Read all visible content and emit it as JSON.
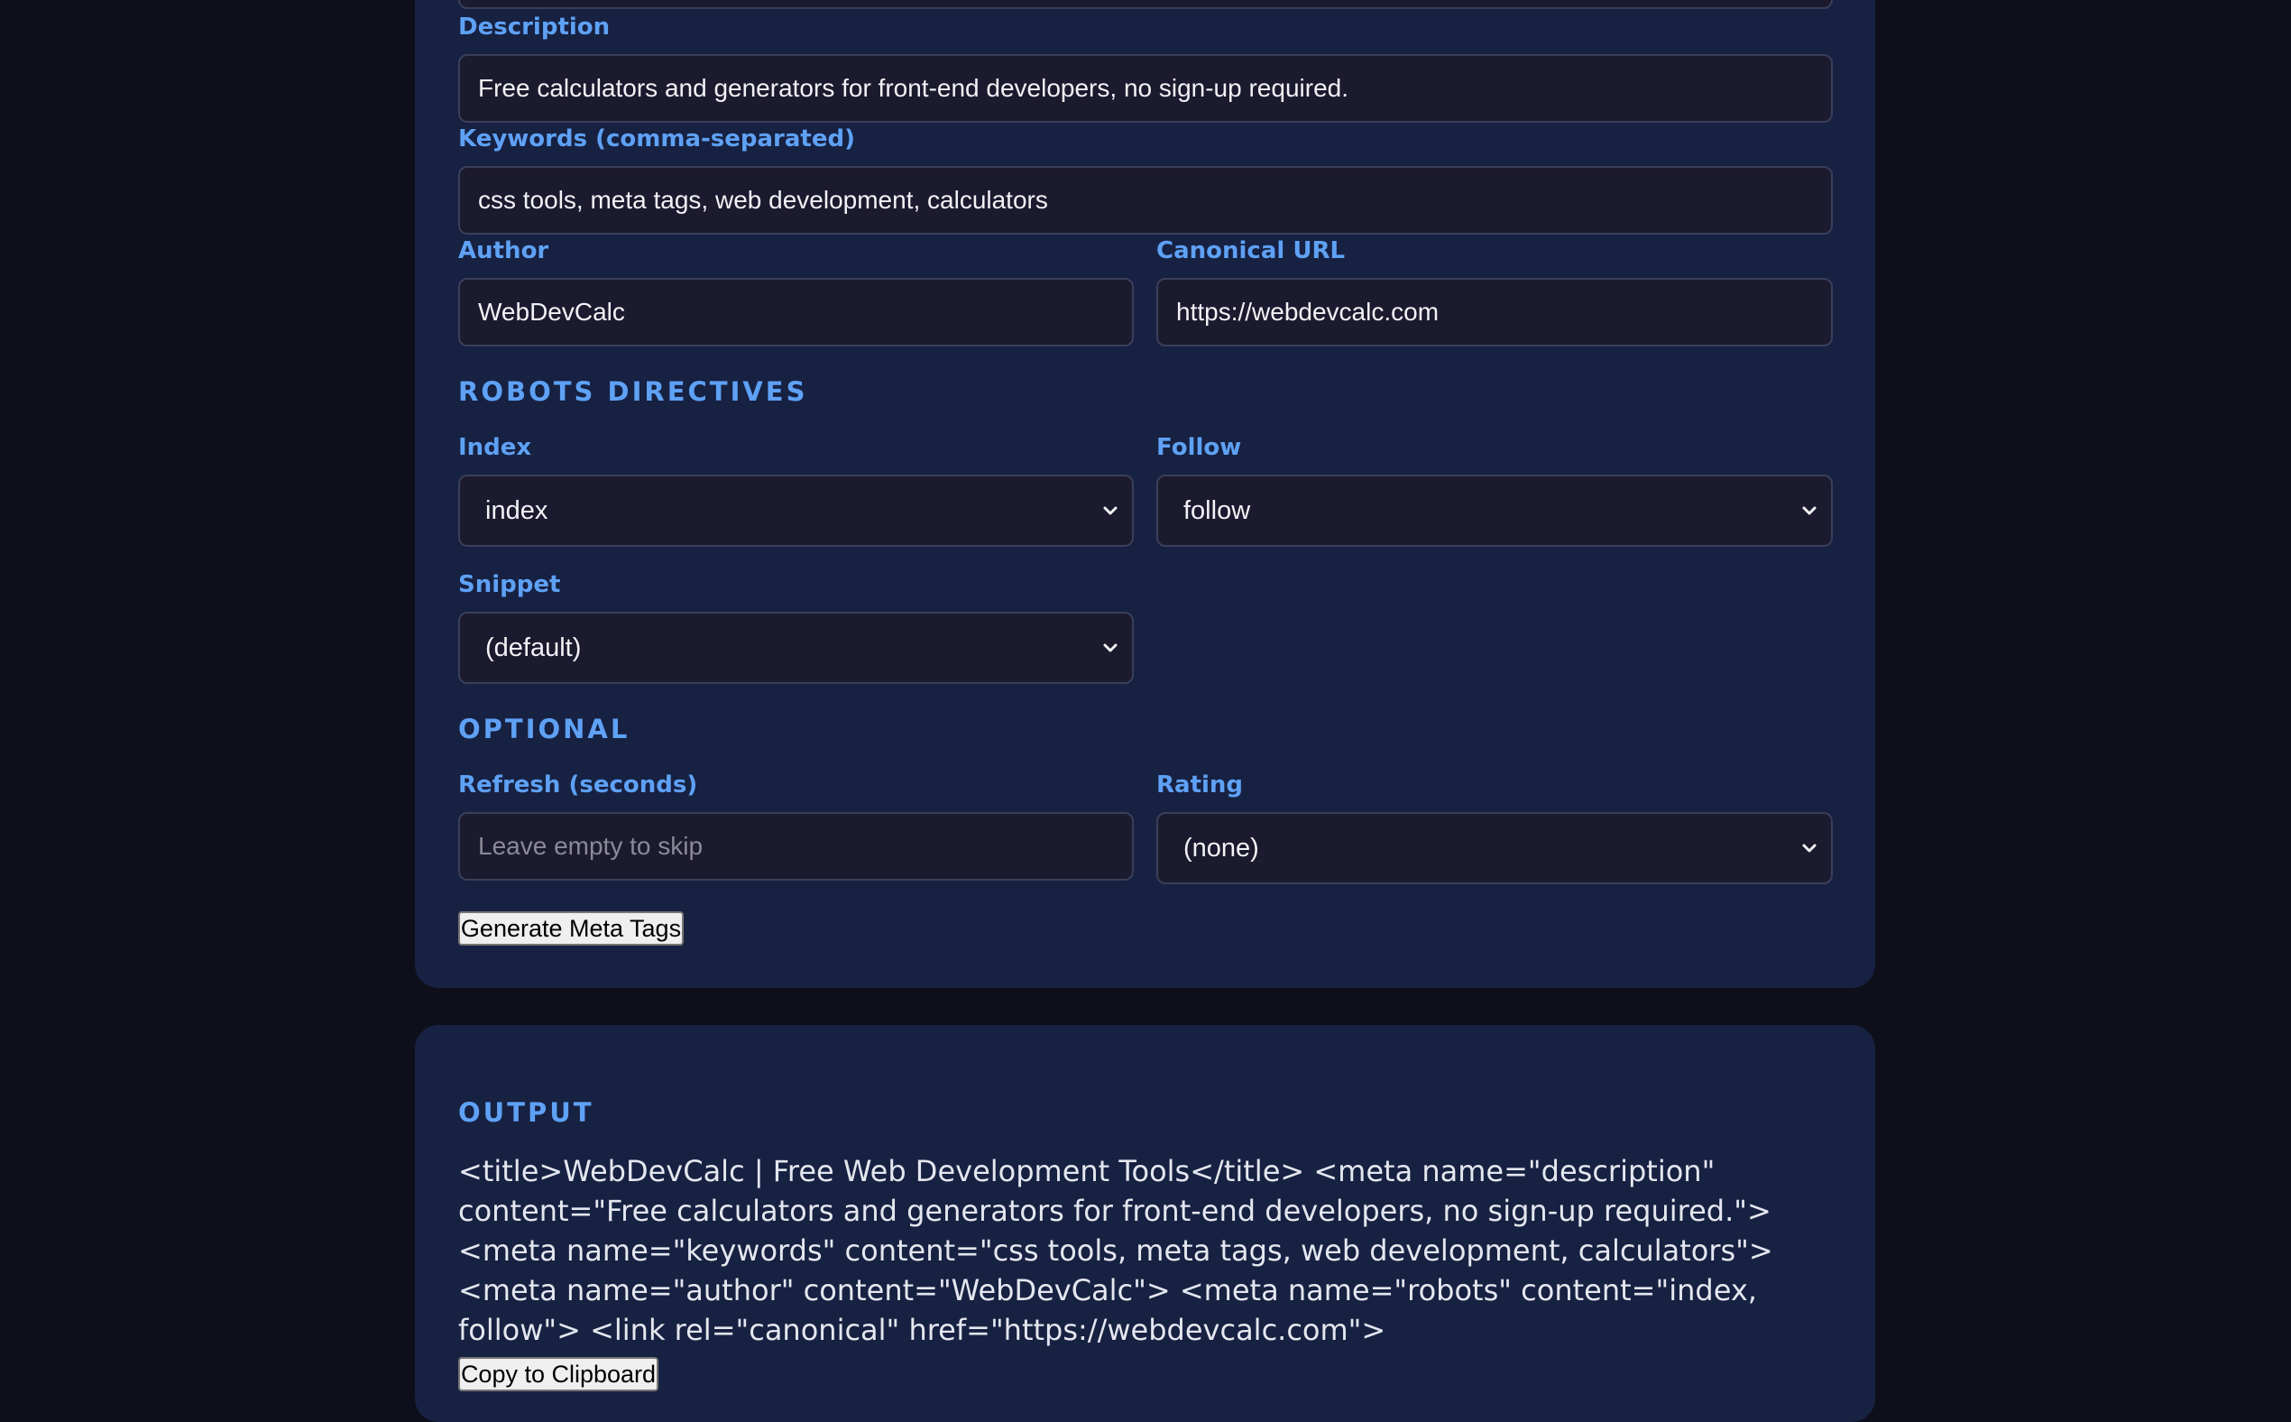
{
  "form": {
    "description": {
      "label": "Description",
      "value": "Free calculators and generators for front-end developers, no sign-up required."
    },
    "keywords": {
      "label": "Keywords (comma-separated)",
      "value": "css tools, meta tags, web development, calculators"
    },
    "author": {
      "label": "Author",
      "value": "WebDevCalc"
    },
    "canonical": {
      "label": "Canonical URL",
      "value": "https://webdevcalc.com"
    },
    "robots_section": "ROBOTS DIRECTIVES",
    "index": {
      "label": "Index",
      "value": "index"
    },
    "follow": {
      "label": "Follow",
      "value": "follow"
    },
    "snippet": {
      "label": "Snippet",
      "value": "(default)"
    },
    "optional_section": "OPTIONAL",
    "refresh": {
      "label": "Refresh (seconds)",
      "placeholder": "Leave empty to skip"
    },
    "rating": {
      "label": "Rating",
      "value": "(none)"
    },
    "generate_button": "Generate Meta Tags"
  },
  "output": {
    "title": "OUTPUT",
    "code": "<title>WebDevCalc | Free Web Development Tools</title> <meta name=\"description\" content=\"Free calculators and generators for front-end developers, no sign-up required.\"> <meta name=\"keywords\" content=\"css tools, meta tags, web development, calculators\"> <meta name=\"author\" content=\"WebDevCalc\"> <meta name=\"robots\" content=\"index, follow\"> <link rel=\"canonical\" href=\"https://webdevcalc.com\">",
    "copy_button": "Copy to Clipboard"
  },
  "colors": {
    "page_background": "#0e0f1a",
    "card_background": "#172142",
    "accent": "#5ea1f5",
    "input_background": "#1c1a2e"
  },
  "icons": {
    "select_arrow": "chevron-down-icon"
  }
}
